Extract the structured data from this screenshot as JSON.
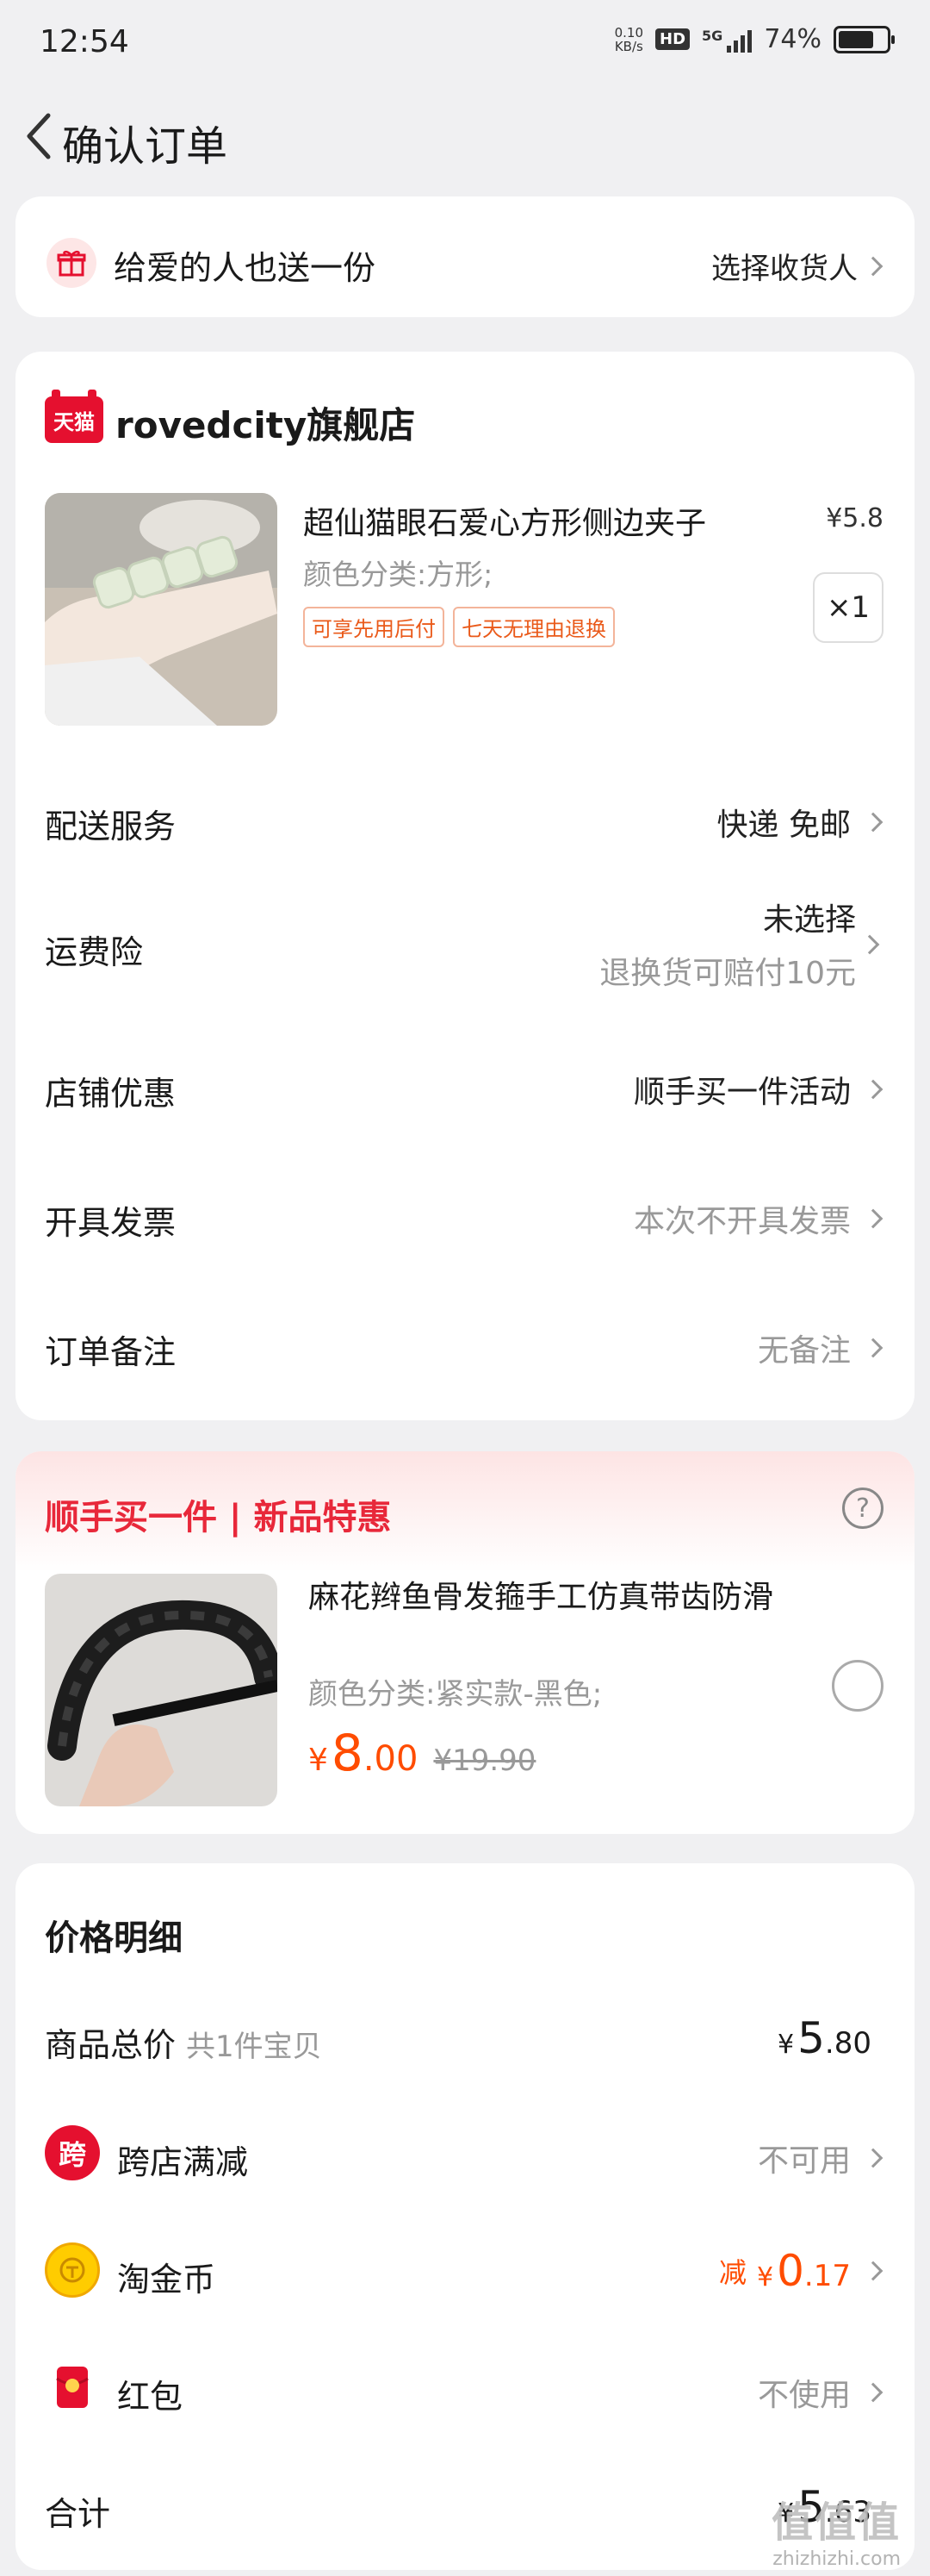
{
  "status_bar": {
    "time": "12:54",
    "net_speed_value": "0.10",
    "net_speed_unit": "KB/s",
    "hd": "HD",
    "network": "5G",
    "battery": "74%",
    "battery_level": 0.74
  },
  "nav": {
    "title": "确认订单"
  },
  "gift": {
    "text": "给爱的人也送一份",
    "action": "选择收货人"
  },
  "store": {
    "badge": "天猫",
    "name": "rovedcity旗舰店",
    "product": {
      "title": "超仙猫眼石爱心方形侧边夹子",
      "price": "¥5.8",
      "spec": "颜色分类:方形;",
      "tags": [
        "可享先用后付",
        "七天无理由退换"
      ],
      "qty": "×1"
    },
    "rows": [
      {
        "label": "配送服务",
        "value": "快递 免邮"
      },
      {
        "label": "运费险",
        "value": "未选择",
        "subvalue": "退换货可赔付10元"
      },
      {
        "label": "店铺优惠",
        "value": "顺手买一件活动"
      },
      {
        "label": "开具发票",
        "value": "本次不开具发票"
      },
      {
        "label": "订单备注",
        "value": "无备注"
      }
    ]
  },
  "promo": {
    "title": "顺手买一件 | 新品特惠",
    "help": "?",
    "product": {
      "title": "麻花辫鱼骨发箍手工仿真带齿防滑",
      "spec": "颜色分类:紧实款-黑色;",
      "currency": "¥",
      "price_int": "8",
      "price_dec": ".00",
      "old_price": "¥19.90"
    }
  },
  "price_detail": {
    "heading": "价格明细",
    "goods_total": {
      "label": "商品总价",
      "sub": "共1件宝贝",
      "currency": "¥",
      "int": "5",
      "dec": ".80"
    },
    "cross_store": {
      "icon": "跨",
      "label": "跨店满减",
      "value": "不可用"
    },
    "coins": {
      "label": "淘金币",
      "prefix": "减",
      "currency": "¥",
      "int": "0",
      "dec": ".17"
    },
    "red_packet": {
      "label": "红包",
      "value": "不使用"
    },
    "total": {
      "label": "合计",
      "currency": "¥",
      "int": "5",
      "dec": ".63"
    }
  },
  "watermark": {
    "brand": "值值值",
    "url": "zhizhizhi.com"
  }
}
